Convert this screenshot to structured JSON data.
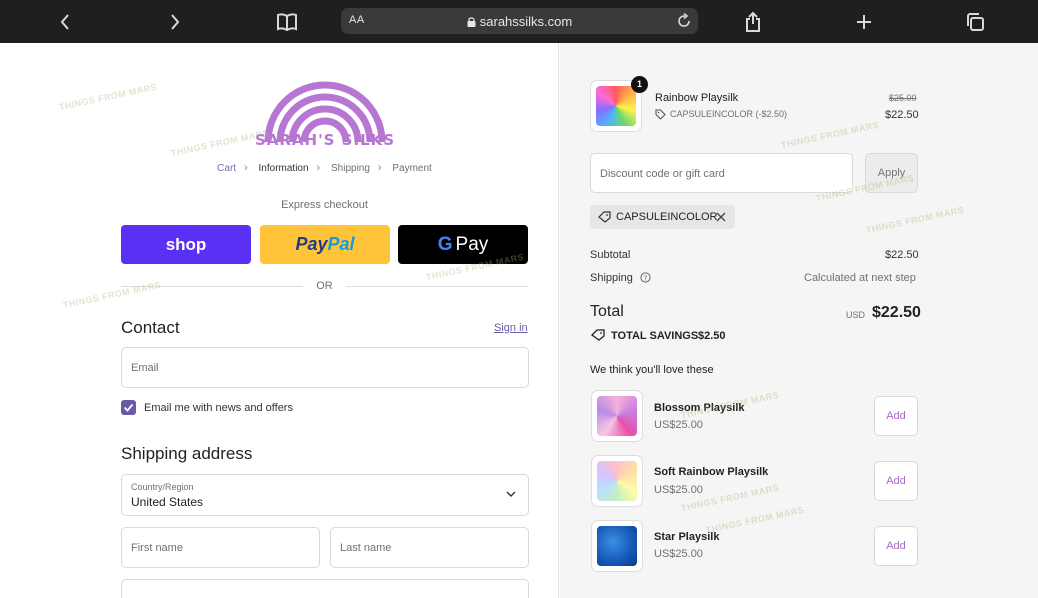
{
  "browser": {
    "aa_label": "AA",
    "url": "sarahssilks.com",
    "icons": [
      "back-icon",
      "forward-icon",
      "bookmarks-icon",
      "lock-icon",
      "reload-icon",
      "share-icon",
      "new-tab-icon",
      "tabs-icon"
    ]
  },
  "brand": {
    "logo_text": "SARAH'S SILKS",
    "accent": "#b776d2"
  },
  "breadcrumb": [
    {
      "label": "Cart"
    },
    {
      "label": "Information"
    },
    {
      "label": "Shipping"
    },
    {
      "label": "Payment"
    }
  ],
  "express": {
    "label": "Express checkout",
    "shop_label": "shop",
    "paypal_a": "Pay",
    "paypal_b": "Pal",
    "gpay_g": "G",
    "gpay_label": "Pay",
    "or_label": "OR"
  },
  "contact": {
    "heading": "Contact",
    "signin": "Sign in",
    "email_placeholder": "Email",
    "newsletter_label": "Email me with news and offers",
    "newsletter_checked": true
  },
  "shipping": {
    "heading": "Shipping address",
    "country_label": "Country/Region",
    "country_value": "United States",
    "first_name_placeholder": "First name",
    "last_name_placeholder": "Last name"
  },
  "order": {
    "item": {
      "name": "Rainbow Playsilk",
      "quantity": "1",
      "discount": "CAPSULEINCOLOR (-$2.50)",
      "original_price": "$25.00",
      "price": "$22.50"
    },
    "discount_placeholder": "Discount code or gift card",
    "apply_label": "Apply",
    "applied_code": "CAPSULEINCOLOR",
    "subtotal_label": "Subtotal",
    "subtotal_value": "$22.50",
    "shipping_label": "Shipping",
    "shipping_value": "Calculated at next step",
    "total_label": "Total",
    "total_currency": "USD",
    "total_value": "$22.50",
    "savings_label": "TOTAL SAVINGS",
    "savings_value": "$2.50"
  },
  "recommendations": {
    "heading": "We think you'll love these",
    "add_label": "Add",
    "items": [
      {
        "name": "Blossom Playsilk",
        "price": "US$25.00"
      },
      {
        "name": "Soft Rainbow Playsilk",
        "price": "US$25.00"
      },
      {
        "name": "Star Playsilk",
        "price": "US$25.00"
      }
    ]
  },
  "watermark": "THINGS FROM MARS"
}
